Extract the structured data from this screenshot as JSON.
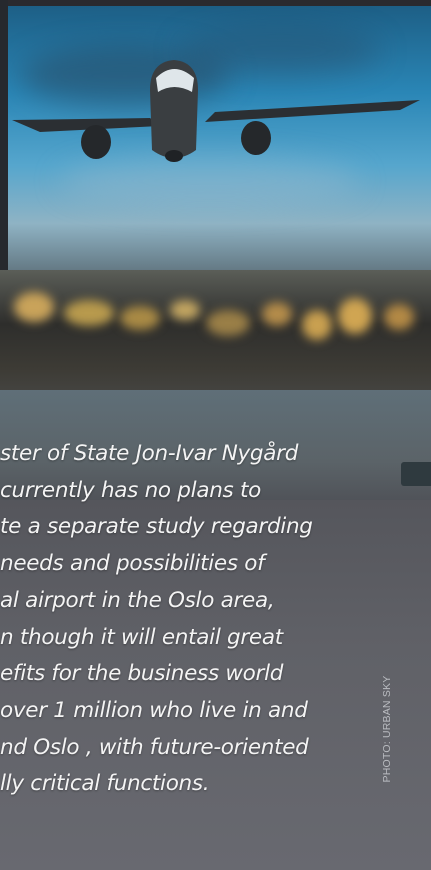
{
  "article": {
    "lines": [
      "ster of State Jon-Ivar Nygård",
      "currently has no plans to",
      "te a separate study regarding",
      "needs and possibilities of",
      "al airport in the Oslo area,",
      "n though it will entail great",
      "efits for the business world",
      "over 1 million who live in and",
      "nd Oslo , with future-oriented",
      "lly critical functions."
    ]
  },
  "photo": {
    "credit": "PHOTO: URBAN SKY",
    "subject": "airliner-taking-off-over-city-lights"
  },
  "colors": {
    "sky": "#2a86b6",
    "body_text": "#f4f4f4",
    "credit_text": "#b9bbc0",
    "background": "#5a5c62"
  }
}
